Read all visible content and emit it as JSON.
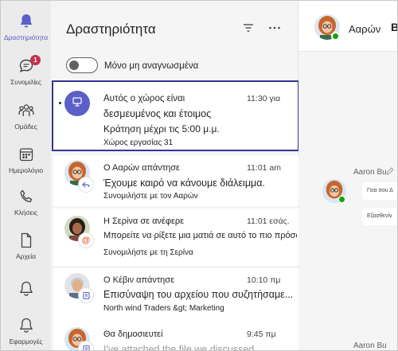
{
  "rail": {
    "items": [
      {
        "label": "Δραστηριότητα",
        "icon": "bell-icon",
        "active": true
      },
      {
        "label": "Συνομιλίες",
        "icon": "chat-icon",
        "badge": "1"
      },
      {
        "label": "Ομάδες",
        "icon": "teams-icon"
      },
      {
        "label": "Ημερολόγιο",
        "icon": "calendar-icon"
      },
      {
        "label": "Κλήσεις",
        "icon": "phone-icon"
      },
      {
        "label": "Αρχεία",
        "icon": "file-icon"
      },
      {
        "label": "",
        "icon": "bell-outline-icon"
      },
      {
        "label": "Εφαρμογές",
        "icon": "bell-apps-icon"
      }
    ]
  },
  "activity": {
    "title": "Δραστηριότητα",
    "filter_icon": "filter-icon",
    "more_icon": "more-icon",
    "toggle_label": "Μόνο μη αναγνωσμένα",
    "items": [
      {
        "title_line1": "Αυτός ο χώρος είναι",
        "title_line2": "δεσμευμένος και έτοιμος",
        "time": "11:30 για",
        "body": "Κράτηση μέχρι τις 5:00 μ.μ.",
        "meta": "Χώρος εργασίας 31",
        "unread": true
      },
      {
        "title": "Ο Ααρών απάντησε",
        "time": "11:01 am",
        "body": "Έχουμε καιρό να κάνουμε διάλειμμα.",
        "meta": "Συνομιλήστε με τον Ααρών"
      },
      {
        "title": "Η Σερίνα σε ανέφερε",
        "time": "11:01 εσάς.",
        "body": "Μπορείτε να ρίξετε μια ματιά σε αυτό το πιο πρόσφατο αρχείο αρχείων;",
        "meta": "Συνομιλήστε με τη Σερίνα"
      },
      {
        "title": "Ο Κέβιν απάντησε",
        "time": "10:10 πμ",
        "body": "Επισύναψη του αρχείου που συζητήσαμε...",
        "meta": "North wind Traders &gt; Marketing"
      },
      {
        "title": "Θα δημοσιευτεί",
        "time": "9:45 πμ",
        "body": "I've attached the file we discussed..."
      }
    ]
  },
  "chat": {
    "name": "Ααρών",
    "b": "Β",
    "author1": "Aaron Bu",
    "bubble1": "Γεια σου Δ",
    "bubble2": "Εξασθενίν",
    "author2": "Aaron Bu"
  },
  "colors": {
    "accent": "#5b5fc7",
    "badge": "#c4314b",
    "selected_border": "#343493",
    "presence": "#13a10e"
  }
}
